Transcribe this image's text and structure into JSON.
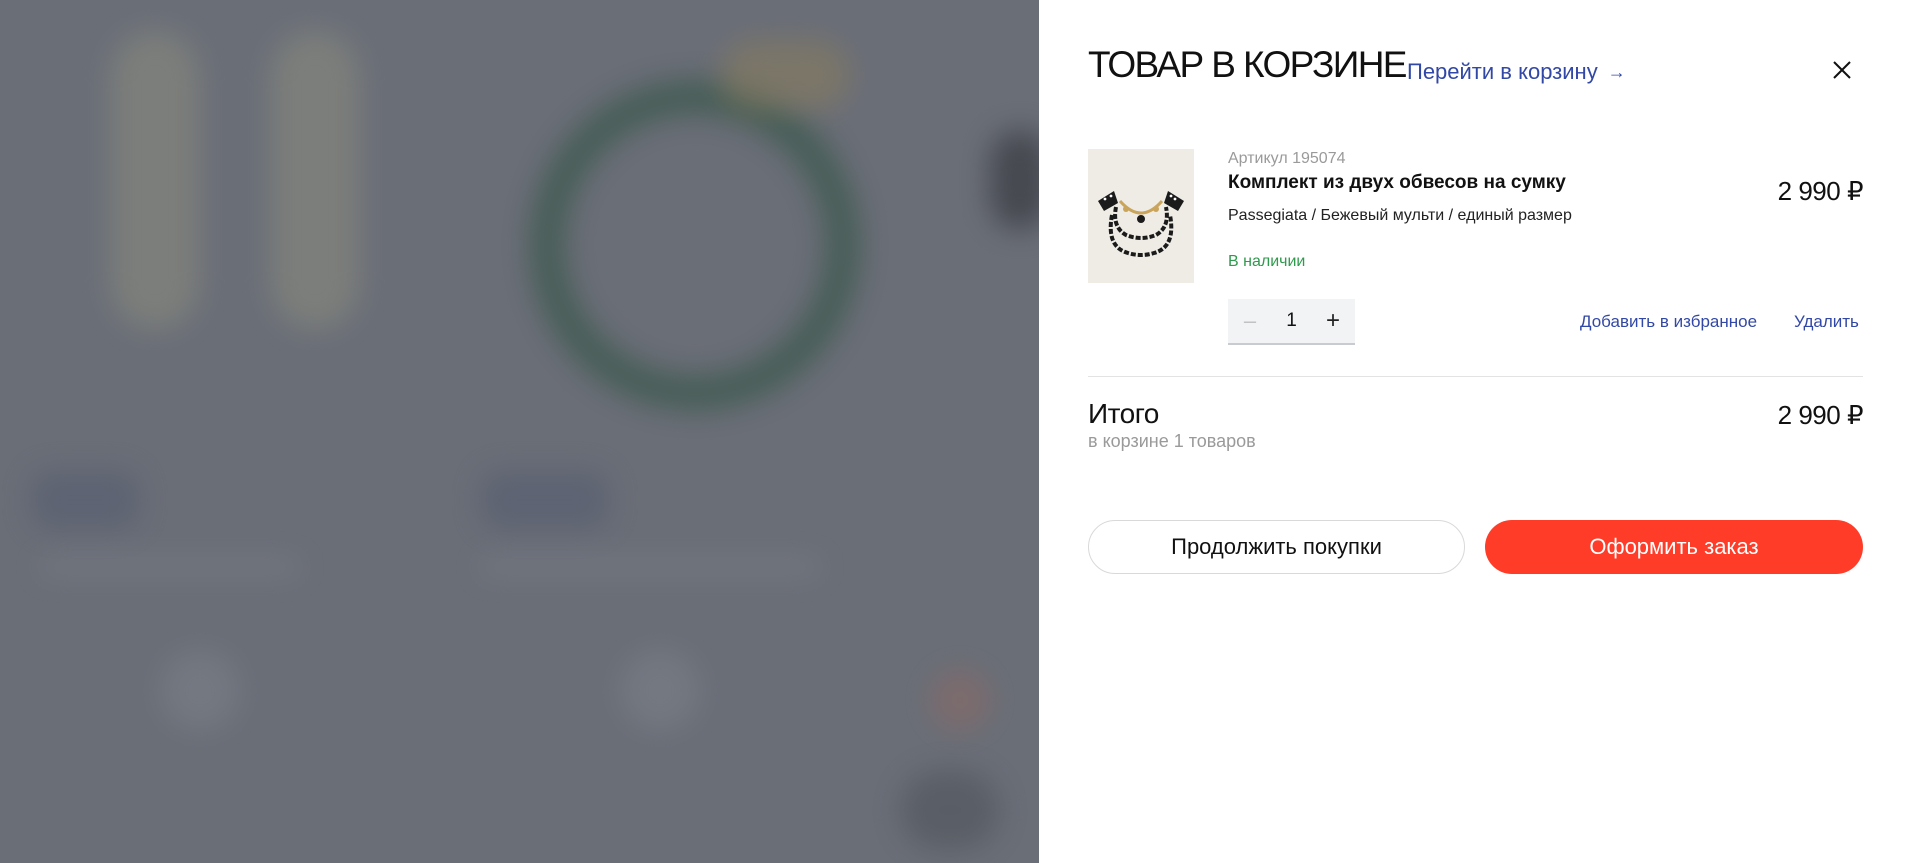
{
  "cart": {
    "title": "ТОВАР В КОРЗИНЕ",
    "goto_cart_label": "Перейти в корзину",
    "goto_cart_arrow": "→",
    "close_icon": "close-icon"
  },
  "item": {
    "sku": "Артикул 195074",
    "name": "Комплект из двух обвесов на сумку",
    "variant": "Passegiata / Бежевый мульти / единый размер",
    "availability": "В наличии",
    "price": "2 990 ₽",
    "quantity": "1",
    "minus_symbol": "–",
    "plus_symbol": "+",
    "add_to_favorites_label": "Добавить в избранное",
    "remove_label": "Удалить",
    "image_icon": "product-thumbnail"
  },
  "summary": {
    "total_label": "Итого",
    "items_count_text": "в корзине 1 товаров",
    "total_price": "2 990 ₽"
  },
  "actions": {
    "continue_label": "Продолжить покупки",
    "checkout_label": "Оформить заказ"
  },
  "colors": {
    "accent": "#ff3c28",
    "link": "#3248a6",
    "in_stock": "#2f9a4d",
    "overlay": "#6a6e77"
  }
}
